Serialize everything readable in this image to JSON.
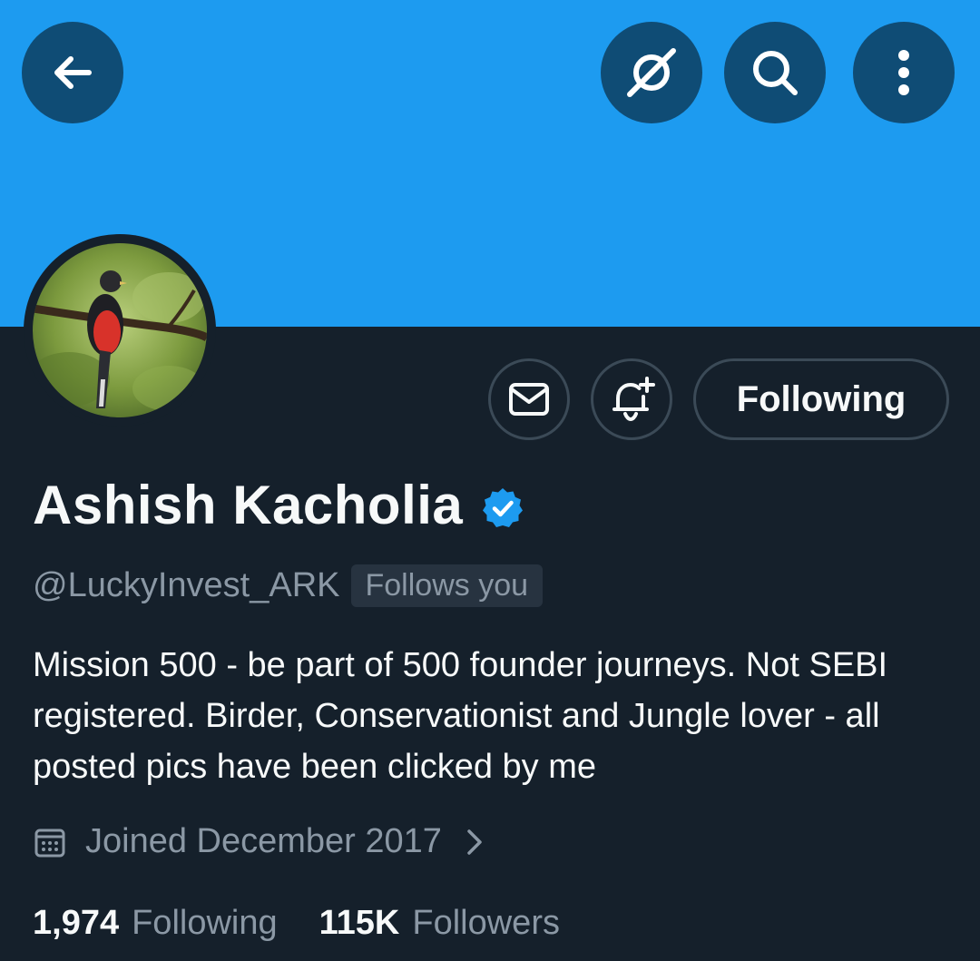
{
  "header": {
    "back_icon": "arrow-left-icon",
    "grok_icon": "slash-circle-icon",
    "search_icon": "search-icon",
    "more_icon": "more-vertical-icon"
  },
  "colors": {
    "banner": "#1d9bf0",
    "background": "#15202b",
    "verified": "#1d9bf0",
    "muted": "#8b98a5"
  },
  "actions": {
    "message_icon": "envelope-icon",
    "notify_icon": "bell-plus-icon",
    "following_label": "Following"
  },
  "profile": {
    "name": "Ashish Kacholia",
    "verified": true,
    "handle": "@LuckyInvest_ARK",
    "follows_you": "Follows you",
    "bio": "Mission 500 - be part of 500 founder journeys. Not SEBI registered. Birder, Conservationist and Jungle lover - all posted pics have been clicked by me",
    "joined": "Joined December 2017"
  },
  "stats": {
    "following_count": "1,974",
    "following_label": "Following",
    "followers_count": "115K",
    "followers_label": "Followers"
  }
}
